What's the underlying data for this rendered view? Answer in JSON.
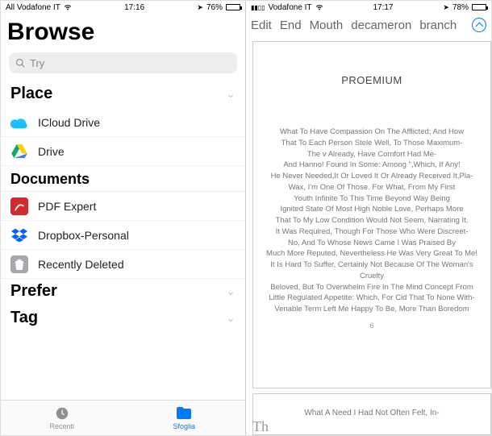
{
  "left": {
    "status": {
      "carrier": "All Vodafone IT",
      "time": "17:16",
      "battery_pct": "76%"
    },
    "title": "Browse",
    "search_placeholder": "Try",
    "sections": {
      "place": {
        "title": "Place",
        "items": [
          {
            "label": "ICloud Drive",
            "icon": "icloud-icon"
          },
          {
            "label": "Drive",
            "icon": "gdrive-icon"
          }
        ]
      },
      "documents": {
        "title": "Documents",
        "items": [
          {
            "label": "PDF Expert",
            "icon": "pdf-expert-icon"
          },
          {
            "label": "Dropbox-Personal",
            "icon": "dropbox-icon"
          },
          {
            "label": "Recently Deleted",
            "icon": "trash-icon"
          }
        ]
      },
      "prefer": {
        "title": "Prefer"
      },
      "tag": {
        "title": "Tag"
      }
    },
    "tabs": {
      "recent": "Recenti",
      "browse": "Sfoglia"
    }
  },
  "right": {
    "status": {
      "carrier": "Vodafone IT",
      "time": "17:17",
      "battery_pct": "78%"
    },
    "header_words": [
      "Edit",
      "End",
      "Mouth",
      "decameron",
      "branch"
    ],
    "page": {
      "title": "PROEMIUM",
      "body": "What To Have Compassion On The Afflicted; And How\nThat To Each Person Stele Well, To Those Maximum-\nThe v Already, Have Comfort Had Me-\nAnd Hanno! Found In Some: Among \",Which, If Any!\nHe Never Needed,It Or Loved It Or Already Received It,Pla-\nWax, I'm One Of Those. For What, From My First\nYouth Infinite To This Time Beyond Way Being\nIgnited State Of Most High Noble Love, Perhaps More\nThat To My Low Condition Would Not Seem, Narrating It,\nIt Was Required, Though For Those Who Were Discreet-\nNo, And To Whose News Came I Was Praised By\nMuch More Reputed, Nevertheless He Was Very Great To Me!\nIt Is Hard To Suffer, Certainly Not Because Of The Woman's Cruelty\nBeloved, But To Overwhelm Fire In The Mind Concept From\nLittle Regulated Appetite: Which, For Cid That To None With-\nVenable Term Left Me Happy To Be, More Than Boredom",
      "page_num": "6",
      "page2_snippet": "What A Need I Had Not Often Felt, In-"
    },
    "thumb_label": "Th"
  }
}
